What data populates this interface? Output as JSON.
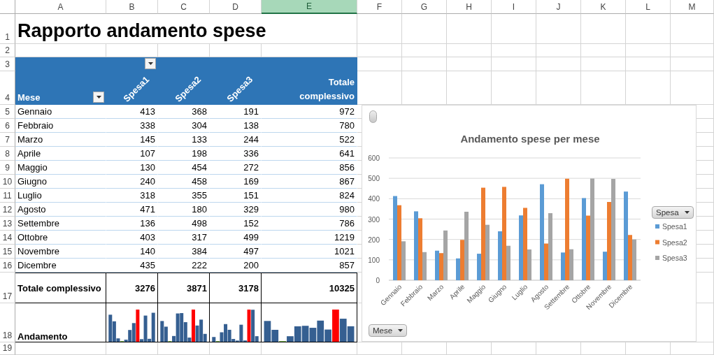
{
  "sheet": {
    "columns": [
      {
        "label": "A",
        "selected": false
      },
      {
        "label": "B",
        "selected": false
      },
      {
        "label": "C",
        "selected": false
      },
      {
        "label": "D",
        "selected": false
      },
      {
        "label": "E",
        "selected": true
      },
      {
        "label": "F",
        "selected": false
      },
      {
        "label": "G",
        "selected": false
      },
      {
        "label": "H",
        "selected": false
      },
      {
        "label": "I",
        "selected": false
      },
      {
        "label": "J",
        "selected": false
      },
      {
        "label": "K",
        "selected": false
      },
      {
        "label": "L",
        "selected": false
      },
      {
        "label": "M",
        "selected": false
      }
    ],
    "row_numbers": [
      "1",
      "2",
      "3",
      "4",
      "5",
      "6",
      "7",
      "8",
      "9",
      "10",
      "11",
      "12",
      "13",
      "14",
      "15",
      "16",
      "17",
      "18",
      "19"
    ]
  },
  "title": "Rapporto andamento spese",
  "pivot": {
    "row_label": "Mese",
    "columns": [
      "Spesa1",
      "Spesa2",
      "Spesa3",
      "Totale complessivo"
    ],
    "rows": [
      {
        "month": "Gennaio",
        "values": [
          "413",
          "368",
          "191",
          "972"
        ]
      },
      {
        "month": "Febbraio",
        "values": [
          "338",
          "304",
          "138",
          "780"
        ]
      },
      {
        "month": "Marzo",
        "values": [
          "145",
          "133",
          "244",
          "522"
        ]
      },
      {
        "month": "Aprile",
        "values": [
          "107",
          "198",
          "336",
          "641"
        ]
      },
      {
        "month": "Maggio",
        "values": [
          "130",
          "454",
          "272",
          "856"
        ]
      },
      {
        "month": "Giugno",
        "values": [
          "240",
          "458",
          "169",
          "867"
        ]
      },
      {
        "month": "Luglio",
        "values": [
          "318",
          "355",
          "151",
          "824"
        ]
      },
      {
        "month": "Agosto",
        "values": [
          "471",
          "180",
          "329",
          "980"
        ]
      },
      {
        "month": "Settembre",
        "values": [
          "136",
          "498",
          "152",
          "786"
        ]
      },
      {
        "month": "Ottobre",
        "values": [
          "403",
          "317",
          "499",
          "1219"
        ]
      },
      {
        "month": "Novembre",
        "values": [
          "140",
          "384",
          "497",
          "1021"
        ]
      },
      {
        "month": "Dicembre",
        "values": [
          "435",
          "222",
          "200",
          "857"
        ]
      }
    ],
    "total": {
      "label": "Totale complessivo",
      "values": [
        "3276",
        "3871",
        "3178",
        "10325"
      ]
    },
    "trend": {
      "label": "Andamento"
    }
  },
  "chart": {
    "legend_button": "Spesa",
    "axis_button": "Mese",
    "chart_data": {
      "type": "bar",
      "title": "Andamento spese per mese",
      "categories": [
        "Gennaio",
        "Febbraio",
        "Marzo",
        "Aprile",
        "Maggio",
        "Giugno",
        "Luglio",
        "Agosto",
        "Settembre",
        "Ottobre",
        "Novembre",
        "Dicembre"
      ],
      "series": [
        {
          "name": "Spesa1",
          "color": "#5b9bd5",
          "values": [
            413,
            338,
            145,
            107,
            130,
            240,
            318,
            471,
            136,
            403,
            140,
            435
          ]
        },
        {
          "name": "Spesa2",
          "color": "#ed7d31",
          "values": [
            368,
            304,
            133,
            198,
            454,
            458,
            355,
            180,
            498,
            317,
            384,
            222
          ]
        },
        {
          "name": "Spesa3",
          "color": "#a5a5a5",
          "values": [
            191,
            138,
            244,
            336,
            272,
            169,
            151,
            329,
            152,
            499,
            497,
            200
          ]
        }
      ],
      "ylim": [
        0,
        600
      ],
      "yticks": [
        0,
        100,
        200,
        300,
        400,
        500,
        600
      ],
      "grid": true,
      "legend": "right"
    }
  }
}
